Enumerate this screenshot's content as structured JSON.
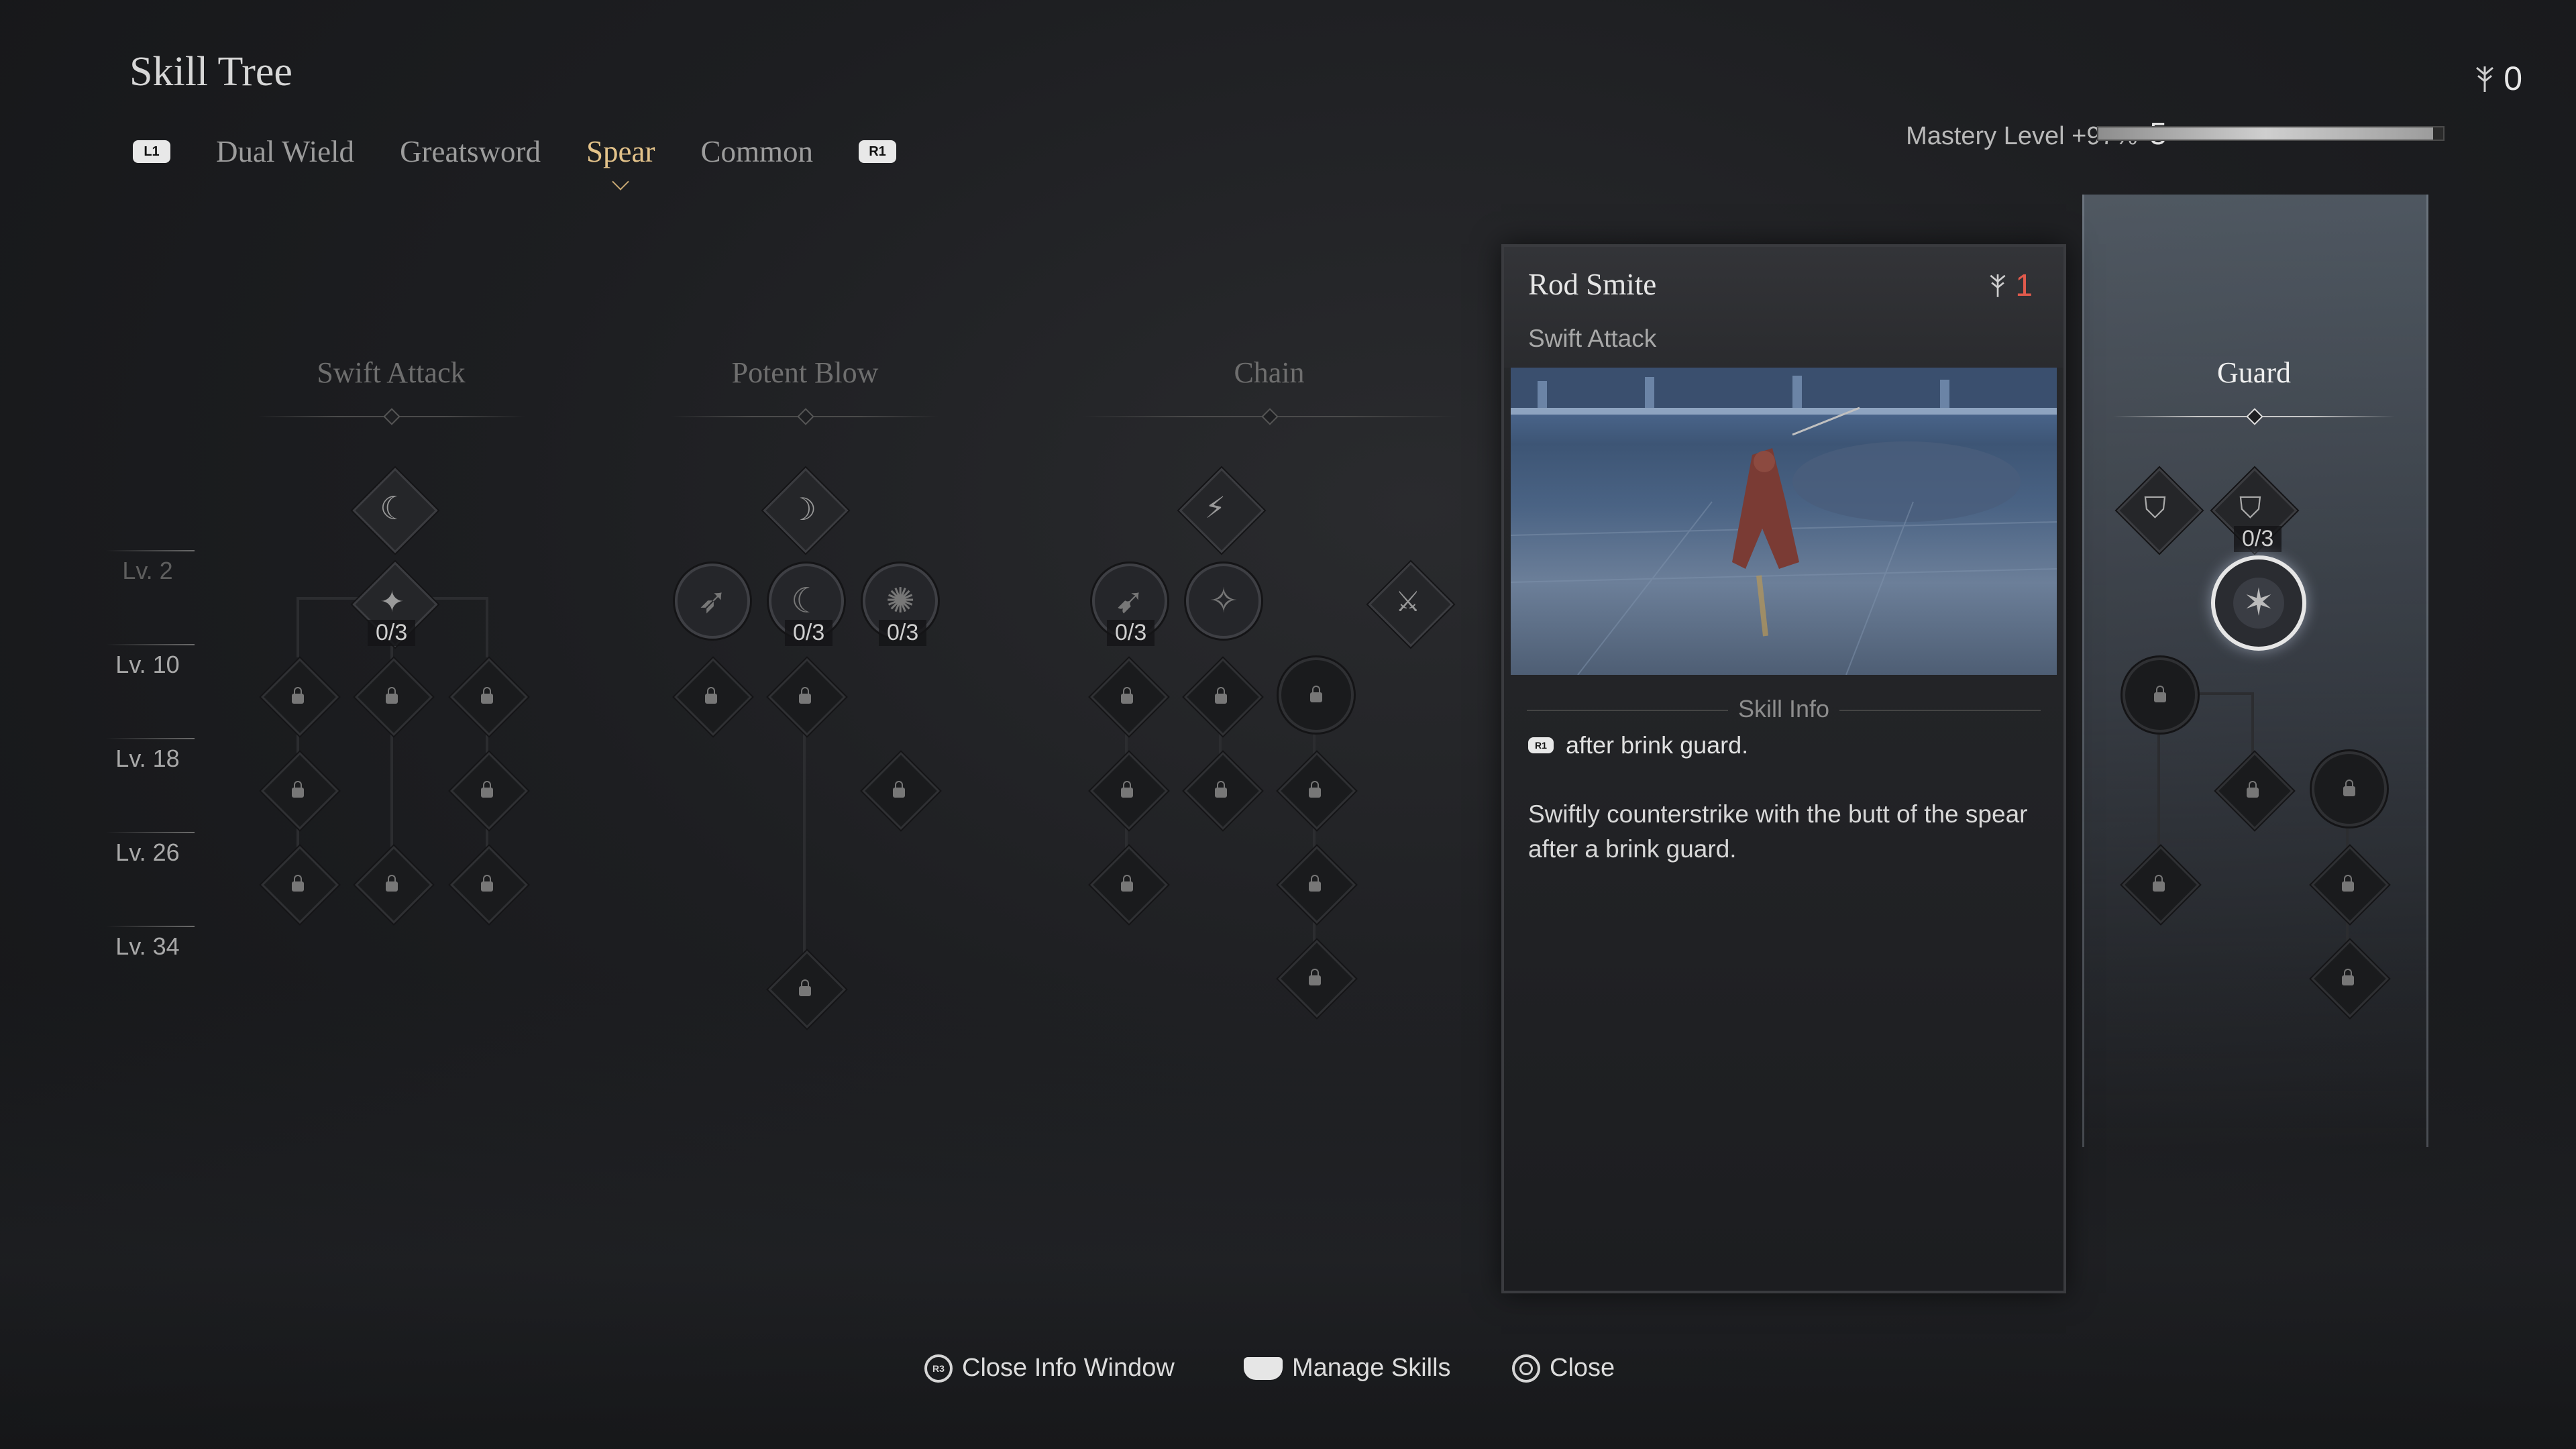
{
  "header": {
    "title": "Skill Tree",
    "tabs": [
      "Dual Wield",
      "Greatsword",
      "Spear",
      "Common"
    ],
    "active_tab": "Spear",
    "left_bumper": "L1",
    "right_bumper": "R1",
    "currency_icon": "skill-point-icon",
    "currency": "0",
    "mastery_label": "Mastery Level +97%",
    "mastery_level": "5",
    "mastery_progress": 0.97
  },
  "levels": [
    "Lv. 2",
    "Lv. 10",
    "Lv. 18",
    "Lv. 26",
    "Lv. 34"
  ],
  "categories": {
    "swift": "Swift Attack",
    "potent": "Potent Blow",
    "chain": "Chain",
    "guard": "Guard"
  },
  "counts": {
    "swift_root": "0/3",
    "potent_2": "0/3",
    "potent_3": "0/3",
    "chain_1": "0/3",
    "guard_2": "0/3"
  },
  "info_panel": {
    "title": "Rod Smite",
    "cost": "1",
    "category": "Swift Attack",
    "section_label": "Skill Info",
    "condition_button": "R1",
    "condition": "after brink guard.",
    "description": "Swiftly counterstrike with the butt of the spear after a brink guard."
  },
  "footer": {
    "close_info": "Close Info Window",
    "close_info_button": "R3",
    "manage": "Manage Skills",
    "close": "Close"
  },
  "colors": {
    "active_tab": "#e3c38a",
    "cost": "#e05a4c",
    "background": "#1d1e21"
  }
}
